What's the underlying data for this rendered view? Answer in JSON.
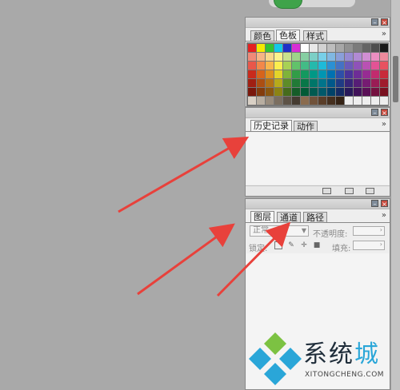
{
  "panels": {
    "swatches": {
      "tabs": [
        "颜色",
        "色板",
        "样式"
      ],
      "active_tab": "色板",
      "more_label": "»",
      "colors": [
        "#e52020",
        "#f5ea00",
        "#33c234",
        "#12c8e8",
        "#1f2fc8",
        "#d82fd6",
        "#ffffff",
        "#e8e8e8",
        "#d2d2d2",
        "#bdbdbd",
        "#a7a7a7",
        "#919191",
        "#7b7b7b",
        "#646464",
        "#4e4e4e",
        "#1a1a1a",
        "#f08a78",
        "#f6b585",
        "#f8d88a",
        "#fbf38d",
        "#c8e28d",
        "#9ed489",
        "#86cfa2",
        "#7ccfc6",
        "#77cfe8",
        "#80b8e2",
        "#8a9fd9",
        "#978ad2",
        "#b18ad3",
        "#d08ed3",
        "#eb8ec1",
        "#ee8a9c",
        "#e9574a",
        "#f2884a",
        "#f8b54d",
        "#fbee4f",
        "#a8d155",
        "#62c26a",
        "#43bb86",
        "#25b9ac",
        "#1ebad8",
        "#2b90d3",
        "#4472c4",
        "#6a5ab9",
        "#8f52b8",
        "#b951b3",
        "#e35395",
        "#e85260",
        "#c92a1c",
        "#d6641b",
        "#de901f",
        "#e3d42a",
        "#7fb33a",
        "#329d47",
        "#14995f",
        "#009886",
        "#0096b2",
        "#0071b1",
        "#2e4fa8",
        "#4a349a",
        "#6e2d97",
        "#972c93",
        "#c22b6e",
        "#c82a3a",
        "#a01f12",
        "#ac4f12",
        "#b37215",
        "#b7aa1b",
        "#5e8c28",
        "#217a36",
        "#087748",
        "#007669",
        "#00748b",
        "#00588a",
        "#1f3b84",
        "#372578",
        "#561d76",
        "#761b72",
        "#9a1c55",
        "#a01c2c",
        "#7a170b",
        "#843c0c",
        "#8a5710",
        "#8c8313",
        "#466b1d",
        "#155c28",
        "#005a36",
        "#005a50",
        "#00596a",
        "#004268",
        "#142b64",
        "#28195a",
        "#41125a",
        "#5a1057",
        "#751140",
        "#7a1120",
        "#d9d0c5",
        "#b8aea1",
        "#988b7c",
        "#7b6e60",
        "#5e5347",
        "#453b31",
        "#8a6b4e",
        "#70523a",
        "#5a3e29",
        "#46301f",
        "#352315",
        "#eeeeee",
        "#eeeeee",
        "#eeeeee",
        "#eeeeee",
        "#eeeeee"
      ]
    },
    "history": {
      "tabs": [
        "历史记录",
        "动作"
      ],
      "active_tab": "历史记录",
      "more_label": "»",
      "footer_icons": [
        "new-snapshot-icon",
        "camera-icon",
        "trash-icon"
      ]
    },
    "layers": {
      "tabs": [
        "图层",
        "通道",
        "路径"
      ],
      "active_tab": "图层",
      "more_label": "»",
      "blend_mode": "正常",
      "opacity_label": "不透明度:",
      "lock_label": "锁定:",
      "fill_label": "填充:"
    }
  },
  "watermark": {
    "text_main": "系统",
    "text_accent": "城",
    "subtext": "XITONGCHENG.COM",
    "logo_colors": [
      "#2aa6d8",
      "#7cc242"
    ]
  },
  "annotation_color": "#e8413b"
}
